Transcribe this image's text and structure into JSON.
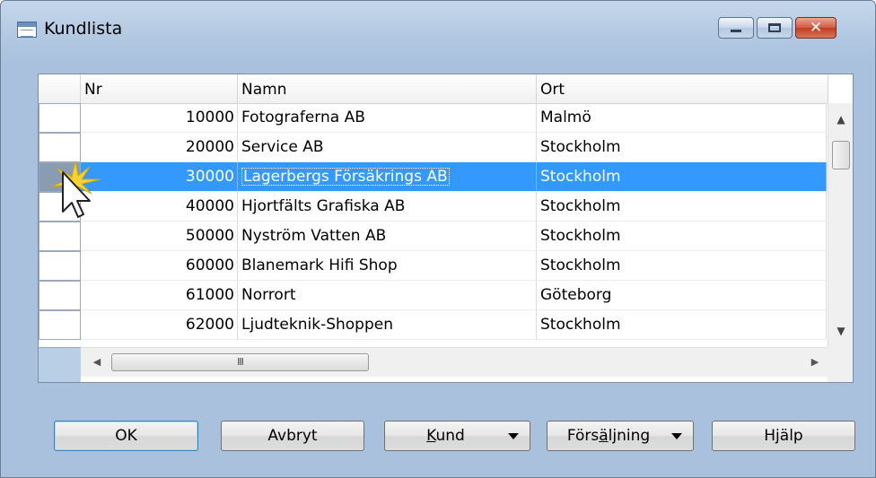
{
  "window": {
    "title": "Kundlista",
    "icon": "table-list-icon",
    "controls": {
      "minimize_icon": "minimize-icon",
      "maximize_icon": "maximize-icon",
      "close_icon": "close-icon",
      "close_glyph": "✕"
    }
  },
  "grid": {
    "columns": [
      {
        "key": "nr",
        "label": "Nr"
      },
      {
        "key": "name",
        "label": "Namn"
      },
      {
        "key": "city",
        "label": "Ort"
      }
    ],
    "selected_index": 2,
    "rows": [
      {
        "nr": "10000",
        "name": "Fotograferna AB",
        "city": "Malmö"
      },
      {
        "nr": "20000",
        "name": "Service AB",
        "city": "Stockholm"
      },
      {
        "nr": "30000",
        "name": "Lagerbergs Försäkrings AB",
        "city": "Stockholm"
      },
      {
        "nr": "40000",
        "name": "Hjortfälts Grafiska AB",
        "city": "Stockholm"
      },
      {
        "nr": "50000",
        "name": "Nyström Vatten AB",
        "city": "Stockholm"
      },
      {
        "nr": "60000",
        "name": "Blanemark Hifi Shop",
        "city": "Stockholm"
      },
      {
        "nr": "61000",
        "name": "Norrort",
        "city": "Göteborg"
      },
      {
        "nr": "62000",
        "name": "Ljudteknik-Shoppen",
        "city": "Stockholm"
      }
    ],
    "hscroll_thumb_grip": "III"
  },
  "buttons": {
    "ok": "OK",
    "cancel": "Avbryt",
    "customer": {
      "mnemonic": "K",
      "rest": "und"
    },
    "sales": {
      "before": "Förs",
      "mnemonic": "ä",
      "after": "ljning"
    },
    "help": "Hjälp"
  },
  "colors": {
    "selection": "#3399ff",
    "window_frame": "#a9c1dd",
    "click_highlight": "#f2d33a"
  }
}
